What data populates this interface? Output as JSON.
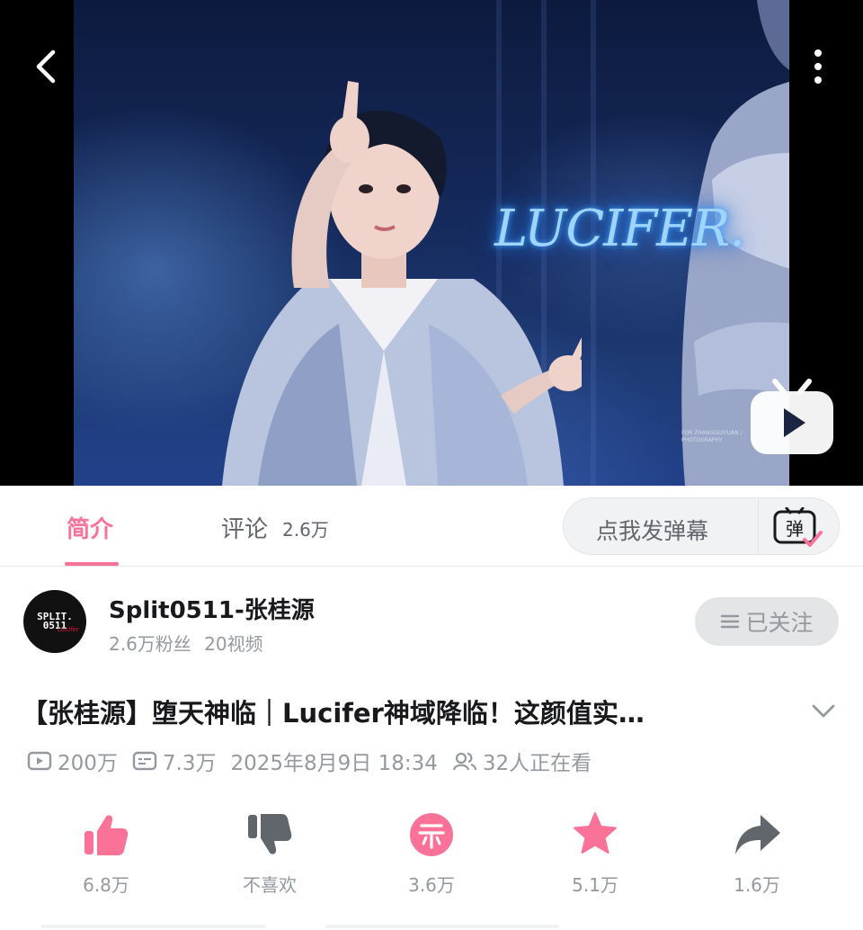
{
  "video": {
    "overlay_text": "LUCIFER.",
    "fine_print": "FOR ZHANGGUIYUAN / PHOTOGRAPHY",
    "back_icon": "chevron-left-icon",
    "more_icon": "more-vertical-icon",
    "play_icon": "tv-play-icon"
  },
  "tabs": {
    "intro_label": "简介",
    "comment_label": "评论",
    "comment_count": "2.6万",
    "danmaku_placeholder": "点我发弹幕",
    "danmaku_icon_text": "弹"
  },
  "uploader": {
    "name": "Split0511-张桂源",
    "fans": "2.6万粉丝",
    "videos": "20视频",
    "follow_label": "已关注",
    "avatar_line1": "SPLIT.",
    "avatar_line2": "0511",
    "avatar_scribble": "Lucifer"
  },
  "video_info": {
    "title": "【张桂源】堕天神临｜Lucifer神域降临！这颜值实…",
    "views": "200万",
    "danmaku_count": "7.3万",
    "published": "2025年8月9日 18:34",
    "watching": "32人正在看"
  },
  "actions": [
    {
      "label": "6.8万",
      "icon": "thumbs-up-icon"
    },
    {
      "label": "不喜欢",
      "icon": "thumbs-down-icon"
    },
    {
      "label": "3.6万",
      "icon": "coin-icon"
    },
    {
      "label": "5.1万",
      "icon": "star-icon"
    },
    {
      "label": "1.6万",
      "icon": "share-icon"
    }
  ],
  "colors": {
    "accent": "#fb7299",
    "text_primary": "#18191c",
    "text_secondary": "#9499a0",
    "dislike_gray": "#61666d"
  }
}
